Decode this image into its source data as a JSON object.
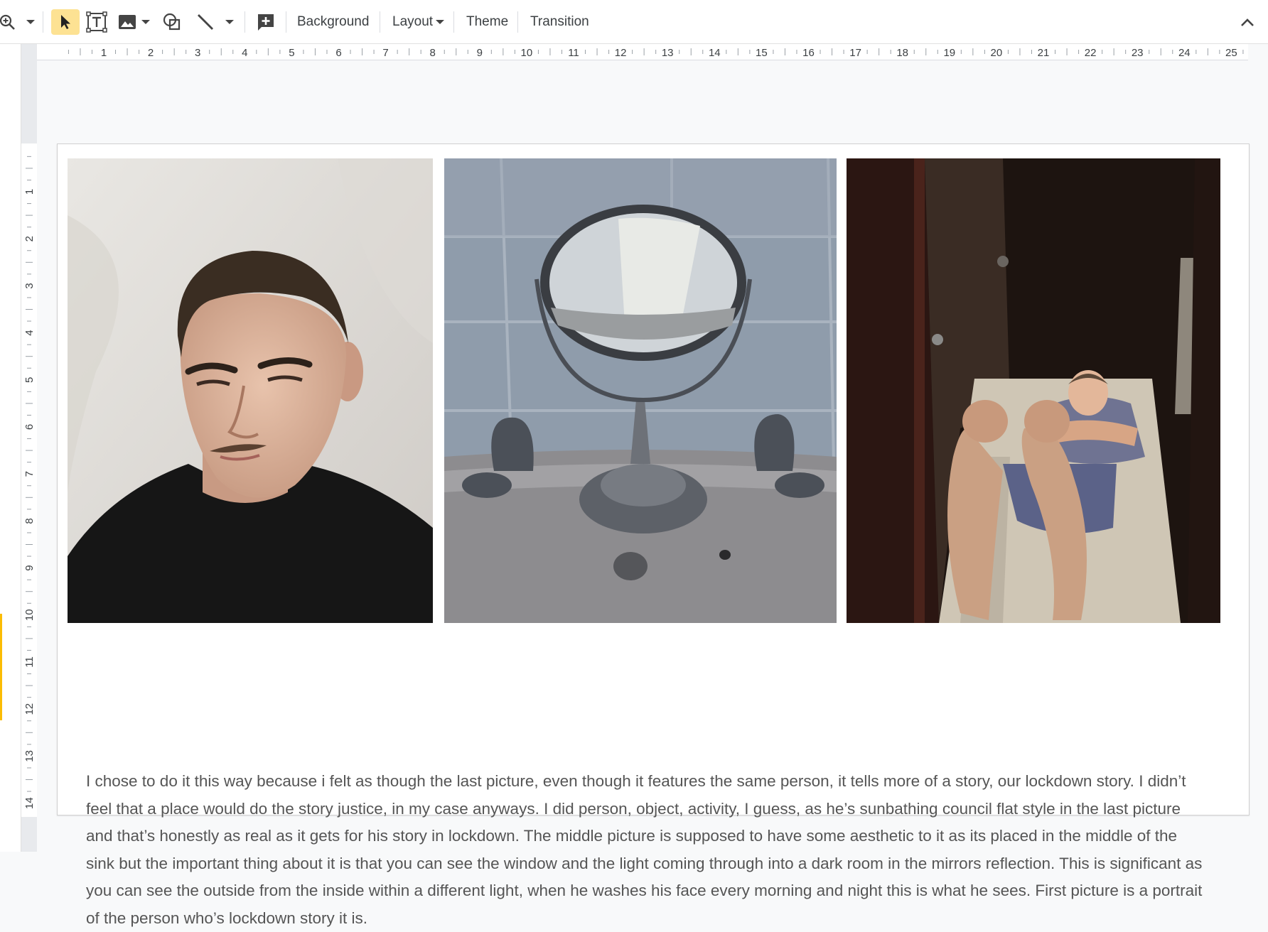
{
  "toolbar": {
    "background_label": "Background",
    "layout_label": "Layout",
    "theme_label": "Theme",
    "transition_label": "Transition",
    "icons": [
      "zoom-icon",
      "dropdown-icon",
      "select-cursor-icon",
      "text-box-icon",
      "image-icon",
      "shape-icon",
      "line-icon",
      "add-comment-icon",
      "collapse-icon"
    ]
  },
  "ruler": {
    "horizontal": [
      "1",
      "2",
      "3",
      "4",
      "5",
      "6",
      "7",
      "8",
      "9",
      "10",
      "11",
      "12",
      "13",
      "14",
      "15",
      "16",
      "17",
      "18",
      "19",
      "20",
      "21",
      "22",
      "23",
      "24",
      "25"
    ],
    "vertical": [
      "1",
      "2",
      "3",
      "4",
      "5",
      "6",
      "7",
      "8",
      "9",
      "10",
      "11",
      "12",
      "13",
      "14"
    ]
  },
  "slide": {
    "photos": [
      "portrait-photo",
      "mirror-photo",
      "sunbathing-photo"
    ],
    "caption": "I chose to do it this way because i felt as though the last picture, even though it features the same person, it tells more of a story, our lockdown story. I didn’t feel that a place would do the story justice, in my case anyways. I did person, object, activity, I guess, as he’s sunbathing council flat style in the last picture and that’s honestly as real as it gets for his story in lockdown. The middle picture is supposed to have some aesthetic to it as its placed in the middle of the sink but the important thing about it is that you can see the window and the light coming through into a dark room in the mirrors reflection. This is significant as you can see the outside from the inside within a different light, when he washes his face every morning and night this is what he sees. First picture is a portrait of the person who’s lockdown story it is."
  },
  "colors": {
    "toolbar_bg": "#ffffff",
    "selected_tool": "#fde293",
    "canvas_bg": "#f8f9fa",
    "caption_text": "#555555"
  }
}
